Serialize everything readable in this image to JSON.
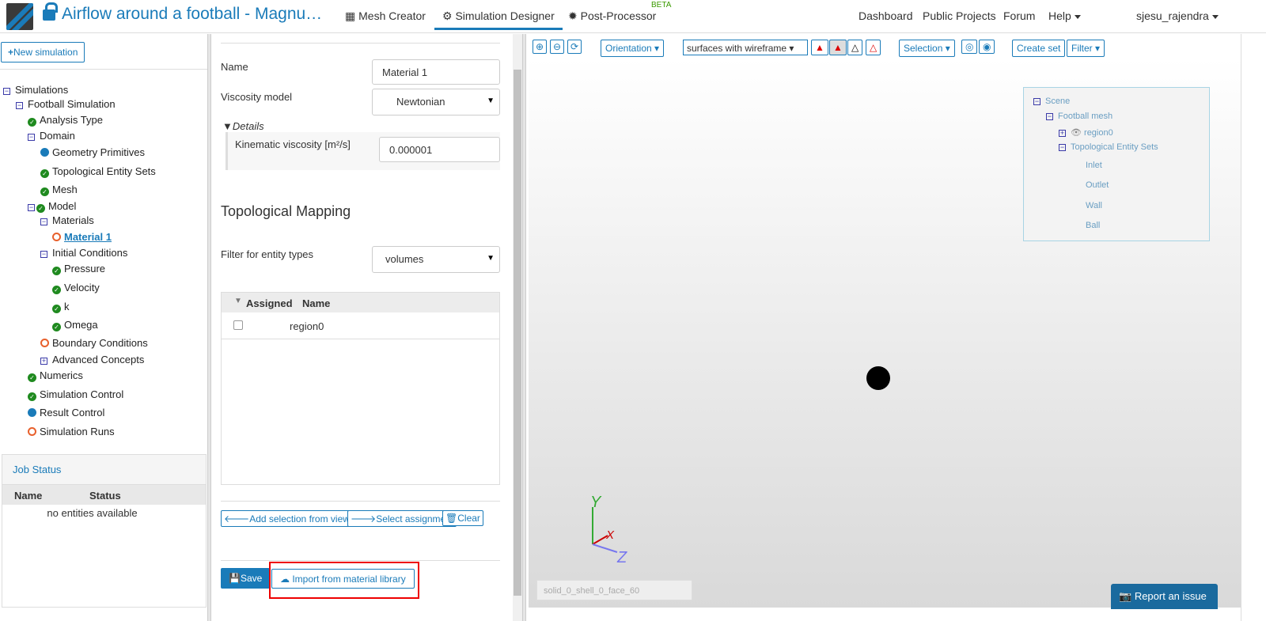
{
  "header": {
    "title": "Airflow around a football - Magnu…",
    "nav": [
      "Mesh Creator",
      "Simulation Designer",
      "Post-Processor"
    ],
    "beta": "BETA",
    "right_nav": [
      "Dashboard",
      "Public Projects",
      "Forum",
      "Help"
    ],
    "user": "sjesu_rajendra"
  },
  "left": {
    "new_simulation": "New simulation",
    "tree": [
      {
        "label": "Simulations",
        "icon": "minus"
      },
      {
        "label": "Football Simulation",
        "icon": "minus"
      },
      {
        "label": "Analysis Type",
        "icon": "check"
      },
      {
        "label": "Domain",
        "icon": "minus"
      },
      {
        "label": "Geometry Primitives",
        "icon": "dot"
      },
      {
        "label": "Topological Entity Sets",
        "icon": "check"
      },
      {
        "label": "Mesh",
        "icon": "check"
      },
      {
        "label": "Model",
        "icon": "check"
      },
      {
        "label": "Materials",
        "icon": "minus"
      },
      {
        "label": "Material 1",
        "icon": "ring"
      },
      {
        "label": "Initial Conditions",
        "icon": "minus"
      },
      {
        "label": "Pressure",
        "icon": "check"
      },
      {
        "label": "Velocity",
        "icon": "check"
      },
      {
        "label": "k",
        "icon": "check"
      },
      {
        "label": "Omega",
        "icon": "check"
      },
      {
        "label": "Boundary Conditions",
        "icon": "ring"
      },
      {
        "label": "Advanced Concepts",
        "icon": "plus"
      },
      {
        "label": "Numerics",
        "icon": "check"
      },
      {
        "label": "Simulation Control",
        "icon": "check"
      },
      {
        "label": "Result Control",
        "icon": "dot"
      },
      {
        "label": "Simulation Runs",
        "icon": "ring"
      }
    ],
    "job_status": {
      "title": "Job Status",
      "columns": [
        "Name",
        "Status"
      ],
      "empty": "no entities available"
    }
  },
  "form": {
    "name_label": "Name",
    "name_value": "Material 1",
    "viscosity_label": "Viscosity model",
    "viscosity_value": "Newtonian",
    "details": "Details",
    "kin_label": "Kinematic viscosity [m²/s]",
    "kin_value": "0.000001",
    "topo_title": "Topological Mapping",
    "filter_label": "Filter for entity types",
    "filter_value": "volumes",
    "table_cols": [
      "Assigned",
      "Name"
    ],
    "rows": [
      {
        "name": "region0",
        "checked": false
      }
    ],
    "add_sel": "Add selection from viewer",
    "select_assign": "Select assignment",
    "clear": "Clear",
    "save": "Save",
    "import": "Import from material library"
  },
  "toolbar": {
    "orientation": "Orientation",
    "render_mode": "surfaces with wireframe",
    "selection": "Selection",
    "create_set": "Create set",
    "filter": "Filter"
  },
  "scene": {
    "root": "Scene",
    "mesh": "Football mesh",
    "region": "region0",
    "sets_label": "Topological Entity Sets",
    "sets": [
      "Inlet",
      "Outlet",
      "Wall",
      "Ball"
    ]
  },
  "viewer": {
    "axes": {
      "x": "X",
      "y": "Y",
      "z": "Z"
    },
    "hover_placeholder": "solid_0_shell_0_face_60",
    "report": "Report an issue"
  }
}
